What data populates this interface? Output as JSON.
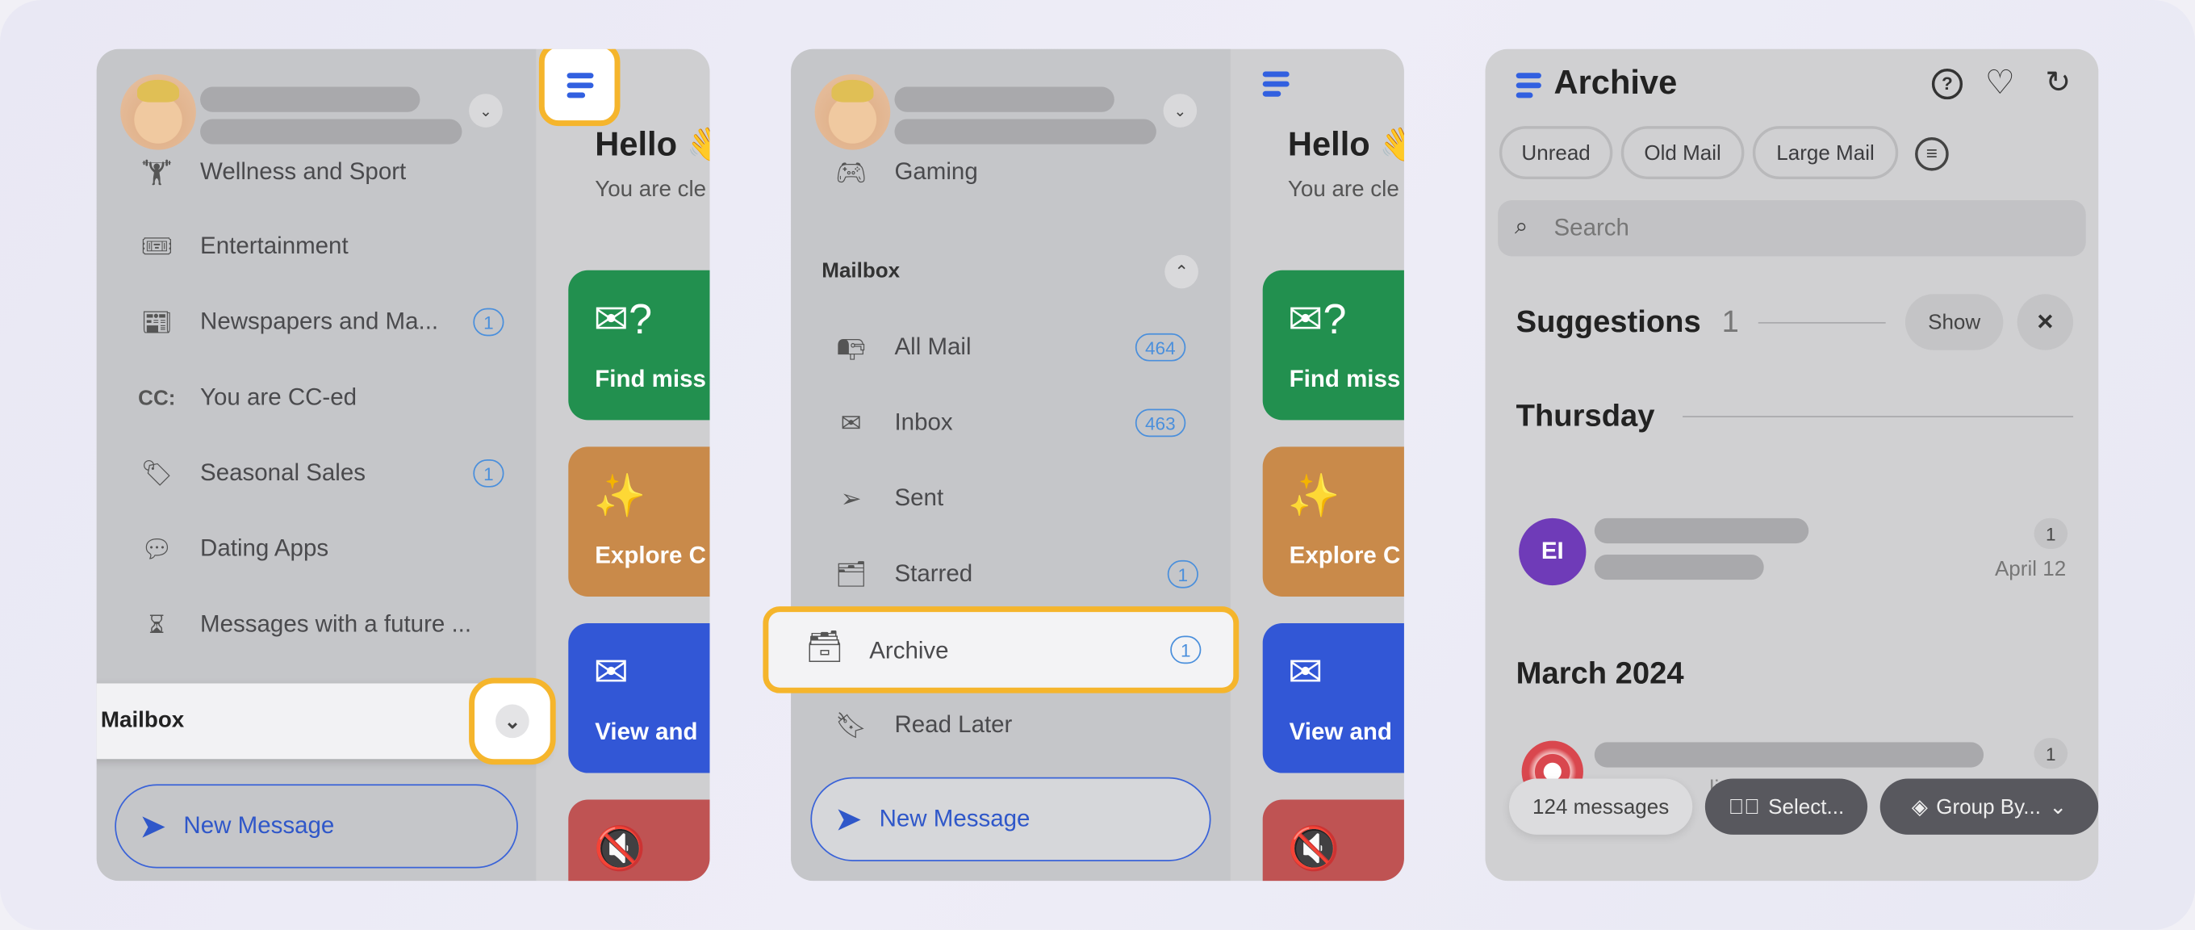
{
  "colors": {
    "accent": "#3260e0",
    "highlight": "#f5b52c",
    "green": "#22904f",
    "orange": "#c98a4a",
    "blue": "#3257d6",
    "red": "#bf5353",
    "avatar_purple": "#6f3bb8"
  },
  "panel1": {
    "items": [
      {
        "label": "Wellness and Sport",
        "icon": "dumbbell-icon"
      },
      {
        "label": "Entertainment",
        "icon": "ticket-icon"
      },
      {
        "label": "Newspapers and Ma...",
        "icon": "newspaper-icon",
        "badge": "1"
      },
      {
        "label": "You are CC-ed",
        "icon": "cc-icon",
        "icon_text": "CC:"
      },
      {
        "label": "Seasonal Sales",
        "icon": "tag-icon",
        "badge": "1"
      },
      {
        "label": "Dating Apps",
        "icon": "heart-bubble-icon"
      },
      {
        "label": "Messages with a future ...",
        "icon": "future-icon"
      }
    ],
    "mailbox_label": "Mailbox",
    "new_message": "New Message",
    "hello": "Hello 👋",
    "subtitle": "You are cle",
    "cards": [
      {
        "label": "Find miss"
      },
      {
        "label": "Explore C"
      },
      {
        "label": "View and"
      },
      {
        "label": ""
      }
    ]
  },
  "panel2": {
    "gaming": "Gaming",
    "mailbox_header": "Mailbox",
    "items": [
      {
        "label": "All Mail",
        "badge": "464",
        "icon": "all-mail-icon"
      },
      {
        "label": "Inbox",
        "badge": "463",
        "icon": "inbox-icon"
      },
      {
        "label": "Sent",
        "icon": "send-icon"
      },
      {
        "label": "Starred",
        "badge": "1",
        "icon": "starred-icon"
      },
      {
        "label": "Archive",
        "badge": "1",
        "icon": "archive-icon"
      },
      {
        "label": "Read Later",
        "icon": "bookmark-icon"
      }
    ],
    "new_message": "New Message",
    "hello": "Hello 👋",
    "subtitle": "You are cle",
    "cards": [
      {
        "label": "Find miss"
      },
      {
        "label": "Explore C"
      },
      {
        "label": "View and"
      },
      {
        "label": ""
      }
    ]
  },
  "panel3": {
    "title": "Archive",
    "chips": [
      "Unread",
      "Old Mail",
      "Large Mail"
    ],
    "search_placeholder": "Search",
    "suggestions": "Suggestions",
    "suggestions_count": "1",
    "show": "Show",
    "close": "×",
    "group1": "Thursday",
    "row1": {
      "initials": "EI",
      "count": "1",
      "date": "April 12"
    },
    "group2": "March 2024",
    "row2": {
      "count": "1",
      "partial": "list"
    },
    "messages_count": "124 messages",
    "select": "Select...",
    "group_by": "Group By..."
  }
}
